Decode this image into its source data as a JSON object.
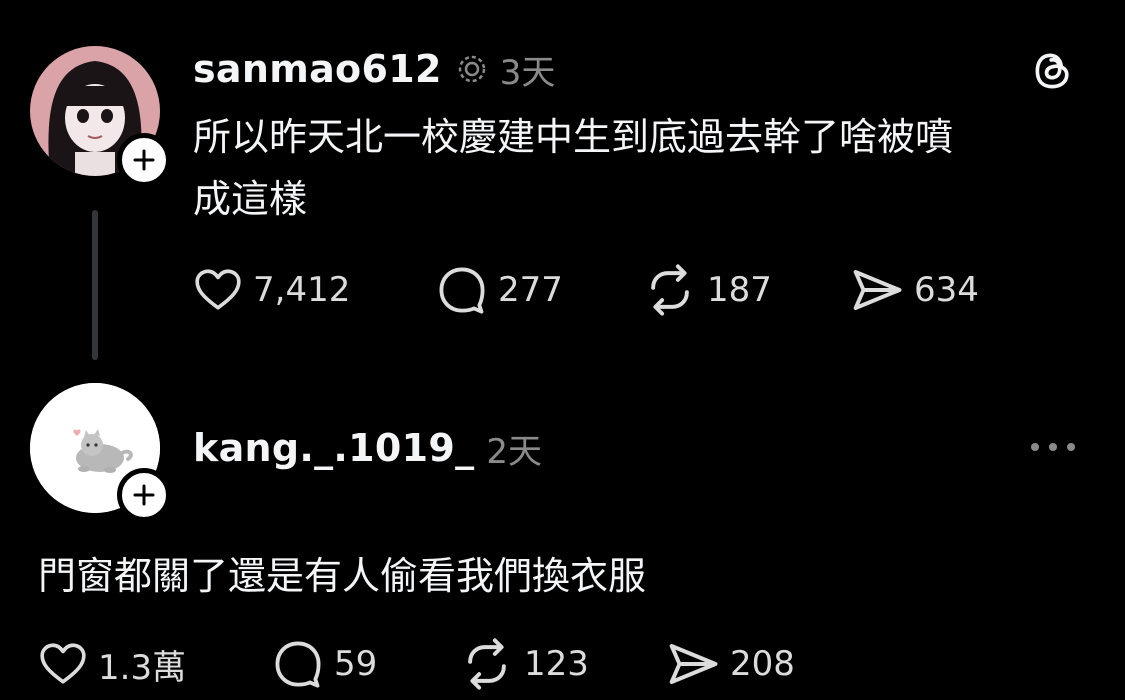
{
  "posts": [
    {
      "username": "sanmao612",
      "time": "3天",
      "text_line1": "所以昨天北一校慶建中生到底過去幹了啥被噴",
      "text_line2": "成這樣",
      "likes": "7,412",
      "comments": "277",
      "reposts": "187",
      "shares": "634"
    },
    {
      "username": "kang._.1019_",
      "time": "2天",
      "text": "門窗都關了還是有人偷看我們換衣服",
      "likes": "1.3萬",
      "comments": "59",
      "reposts": "123",
      "shares": "208"
    }
  ],
  "icons": {
    "threads_logo": "threads-logo-icon",
    "more": "more-options-icon",
    "like": "heart-icon",
    "comment": "comment-bubble-icon",
    "repost": "repost-icon",
    "share": "send-icon",
    "follow": "plus-icon"
  },
  "colors": {
    "background": "#000000",
    "text_primary": "#f3f5f7",
    "text_secondary": "#8a8a8a"
  }
}
